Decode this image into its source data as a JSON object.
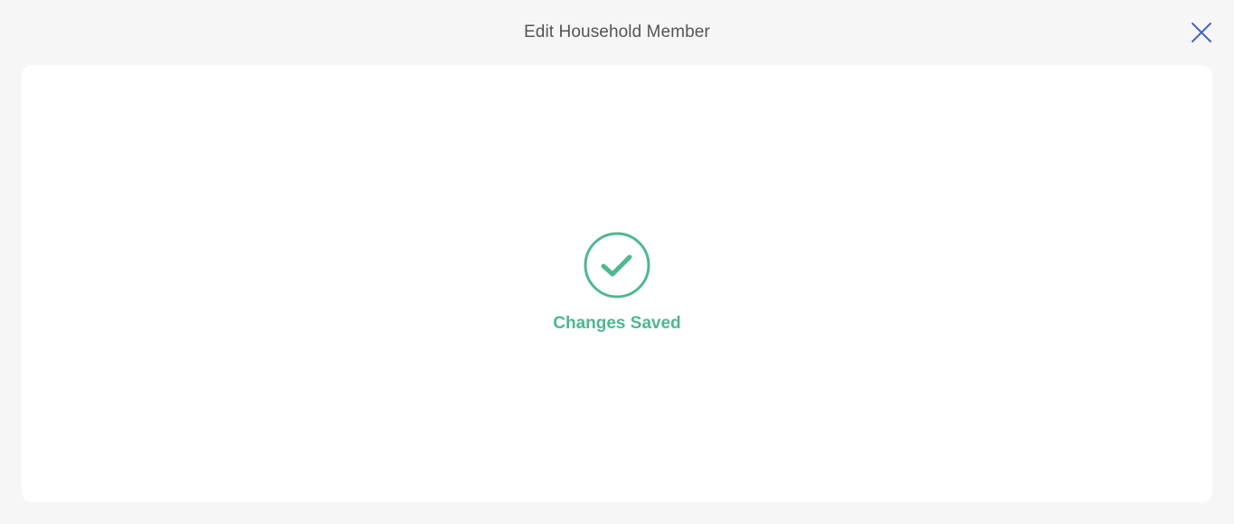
{
  "dialog": {
    "title": "Edit Household Member",
    "close_icon": "close-icon"
  },
  "status": {
    "icon": "check-circle-icon",
    "message": "Changes Saved"
  },
  "colors": {
    "success": "#4db88e",
    "close": "#4a63c6",
    "title": "#555555",
    "background": "#f6f6f6",
    "panel": "#ffffff"
  }
}
